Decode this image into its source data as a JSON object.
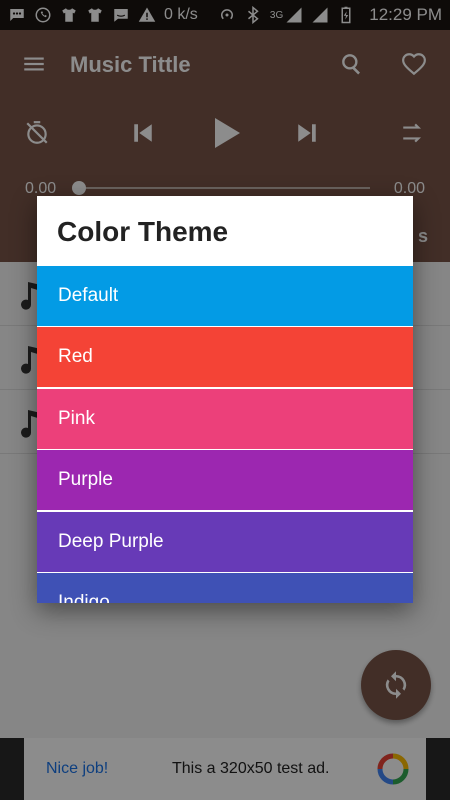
{
  "status_bar": {
    "speed": "0 k/s",
    "network": "3G",
    "time": "12:29 PM"
  },
  "app": {
    "title": "Music Tittle",
    "header_tab_partial": "s",
    "time_start": "0.00",
    "time_end": "0.00",
    "header_color": "#795548"
  },
  "songs": [
    {
      "icon": "music-note-icon"
    },
    {
      "icon": "music-note-icon"
    },
    {
      "icon": "music-note-icon"
    }
  ],
  "dialog": {
    "title": "Color Theme",
    "themes": [
      {
        "label": "Default",
        "color": "#039BE5"
      },
      {
        "label": "Red",
        "color": "#F44336"
      },
      {
        "label": "Pink",
        "color": "#EC407A"
      },
      {
        "label": "Purple",
        "color": "#9C27B0"
      },
      {
        "label": "Deep Purple",
        "color": "#673AB7"
      },
      {
        "label": "Indigo",
        "color": "#3F51B5"
      }
    ]
  },
  "ad": {
    "nice": "Nice job!",
    "text": "This a 320x50 test ad."
  }
}
